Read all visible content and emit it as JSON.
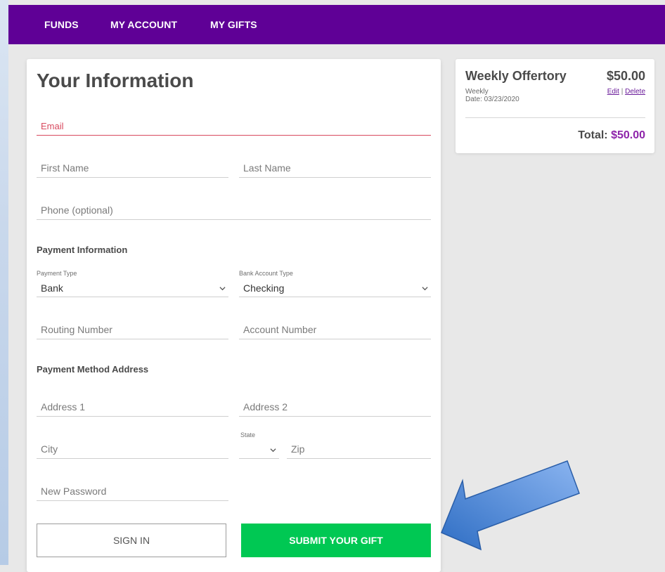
{
  "nav": {
    "items": [
      "FUNDS",
      "MY ACCOUNT",
      "MY GIFTS"
    ]
  },
  "form": {
    "title": "Your Information",
    "email_placeholder": "Email",
    "first_name_placeholder": "First Name",
    "last_name_placeholder": "Last Name",
    "phone_placeholder": "Phone (optional)",
    "payment_section": "Payment Information",
    "payment_type_label": "Payment Type",
    "payment_type_value": "Bank",
    "bank_account_type_label": "Bank Account Type",
    "bank_account_type_value": "Checking",
    "routing_placeholder": "Routing Number",
    "account_placeholder": "Account Number",
    "address_section": "Payment Method Address",
    "address1_placeholder": "Address 1",
    "address2_placeholder": "Address 2",
    "city_placeholder": "City",
    "state_label": "State",
    "state_value": "",
    "zip_placeholder": "Zip",
    "password_placeholder": "New Password",
    "sign_in_label": "SIGN IN",
    "submit_label": "SUBMIT YOUR GIFT"
  },
  "summary": {
    "fund_name": "Weekly Offertory",
    "amount": "$50.00",
    "frequency": "Weekly",
    "date": "Date: 03/23/2020",
    "edit_label": "Edit",
    "separator": "|",
    "delete_label": "Delete",
    "total_label": "Total:",
    "total_amount": "$50.00"
  },
  "colors": {
    "nav_bg": "#5f0096",
    "submit_bg": "#00c853",
    "error": "#d84a5f",
    "total_accent": "#8e24aa",
    "arrow": "#4a86d8"
  },
  "icons": [
    "chevron-down-icon",
    "pointer-arrow"
  ]
}
